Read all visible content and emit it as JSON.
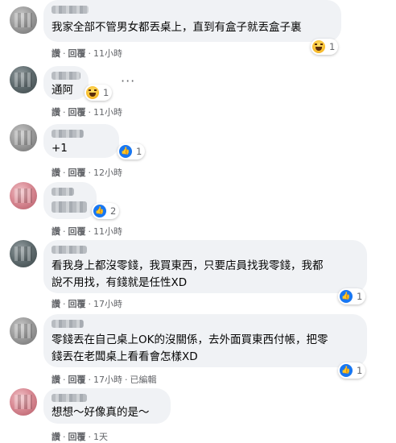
{
  "comments": [
    {
      "text": [
        "我家全部不管男女都丟桌上，直到有盒子就丟盒子裏"
      ],
      "reaction": "haha",
      "reaction_count": "1",
      "like_label": "讚",
      "reply_label": "回覆",
      "time": "11小時",
      "edited": ""
    },
    {
      "text": [
        "通阿"
      ],
      "reaction": "haha",
      "reaction_count": "1",
      "like_label": "讚",
      "reply_label": "回覆",
      "time": "11小時",
      "edited": ""
    },
    {
      "text": [
        "+1"
      ],
      "reaction": "like",
      "reaction_count": "1",
      "like_label": "讚",
      "reply_label": "回覆",
      "time": "12小時",
      "edited": ""
    },
    {
      "text": [],
      "reaction": "like",
      "reaction_count": "2",
      "like_label": "讚",
      "reply_label": "回覆",
      "time": "11小時",
      "edited": ""
    },
    {
      "text": [
        "看我身上都沒零錢，我買東西，只要店員找我零錢，我都",
        "說不用找，有錢就是任性XD"
      ],
      "reaction": "like",
      "reaction_count": "1",
      "like_label": "讚",
      "reply_label": "回覆",
      "time": "17小時",
      "edited": ""
    },
    {
      "text": [
        "零錢丟在自己桌上OK的沒關係，去外面買東西付帳，把零",
        "錢丟在老闆桌上看看會怎樣XD"
      ],
      "reaction": "like",
      "reaction_count": "1",
      "like_label": "讚",
      "reply_label": "回覆",
      "time": "17小時",
      "edited": "已編輯"
    },
    {
      "text": [
        "想想～好像真的是～"
      ],
      "reaction": "",
      "reaction_count": "",
      "like_label": "讚",
      "reply_label": "回覆",
      "time": "1天",
      "edited": ""
    }
  ],
  "more_icon": "more-horizontal-icon",
  "colors": {
    "bubble": "#f0f2f5",
    "meta_text": "#65676b",
    "like_blue": "#1877f2",
    "haha_yellow": "#f7b928"
  }
}
